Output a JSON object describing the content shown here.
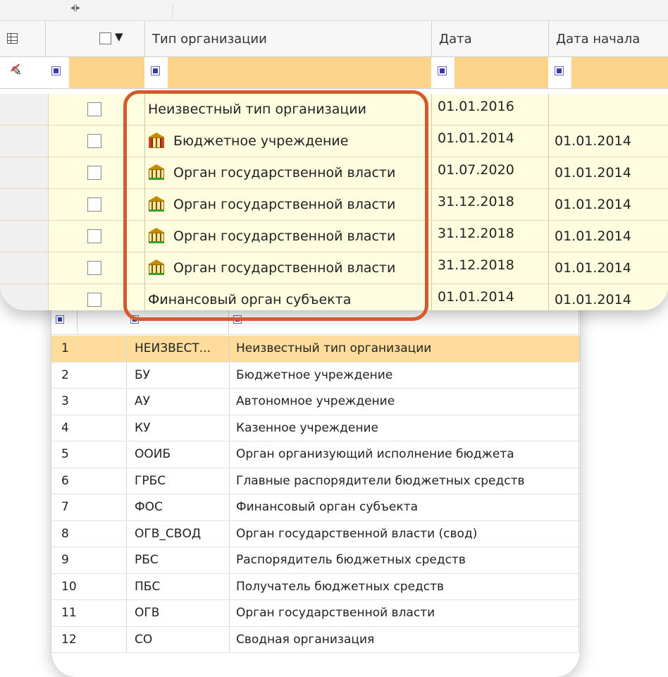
{
  "grid": {
    "header": {
      "grid_icon": "table-grid-icon",
      "col_type": "Тип организации",
      "col_date": "Дата",
      "col_start": "Дата начала"
    },
    "rows": [
      {
        "type": "Неизвестный тип организации",
        "icon": "",
        "date": "01.01.2016",
        "start": ""
      },
      {
        "type": "Бюджетное учреждение",
        "icon": "building-red-icon",
        "date": "01.01.2014",
        "start": "01.01.2014"
      },
      {
        "type": "Орган государственной власти",
        "icon": "building-green-icon",
        "date": "01.07.2020",
        "start": "01.01.2014"
      },
      {
        "type": "Орган государственной власти",
        "icon": "building-green-icon",
        "date": "31.12.2018",
        "start": "01.01.2014"
      },
      {
        "type": "Орган государственной власти",
        "icon": "building-green-icon",
        "date": "31.12.2018",
        "start": "01.01.2014"
      },
      {
        "type": "Орган государственной власти",
        "icon": "building-green-icon",
        "date": "31.12.2018",
        "start": "01.01.2014"
      },
      {
        "type": "Финансовый орган субъекта",
        "icon": "",
        "date": "01.01.2014",
        "start": "01.01.2014"
      }
    ],
    "highlight_color": "#d35a2b",
    "filter_color": "#fcd48a",
    "row_color": "#fffde0"
  },
  "lookup": {
    "selected_color": "#fddc9c",
    "rows": [
      {
        "id": "1",
        "code": "НЕИЗВЕСТ...",
        "name": "Неизвестный тип организации"
      },
      {
        "id": "2",
        "code": "БУ",
        "name": "Бюджетное учреждение"
      },
      {
        "id": "3",
        "code": "АУ",
        "name": "Автономное учреждение"
      },
      {
        "id": "4",
        "code": "КУ",
        "name": "Казенное учреждение"
      },
      {
        "id": "5",
        "code": "ООИБ",
        "name": "Орган организующий исполнение бюджета"
      },
      {
        "id": "6",
        "code": "ГРБС",
        "name": "Главные распорядители бюджетных средств"
      },
      {
        "id": "7",
        "code": "ФОС",
        "name": "Финансовый орган субъекта"
      },
      {
        "id": "8",
        "code": "ОГВ_СВОД",
        "name": "Орган государственной власти (свод)"
      },
      {
        "id": "9",
        "code": "РБС",
        "name": "Распорядитель бюджетных средств"
      },
      {
        "id": "10",
        "code": "ПБС",
        "name": "Получатель бюджетных средств"
      },
      {
        "id": "11",
        "code": "ОГВ",
        "name": "Орган государственной власти"
      },
      {
        "id": "12",
        "code": "СО",
        "name": "Сводная организация"
      }
    ]
  }
}
